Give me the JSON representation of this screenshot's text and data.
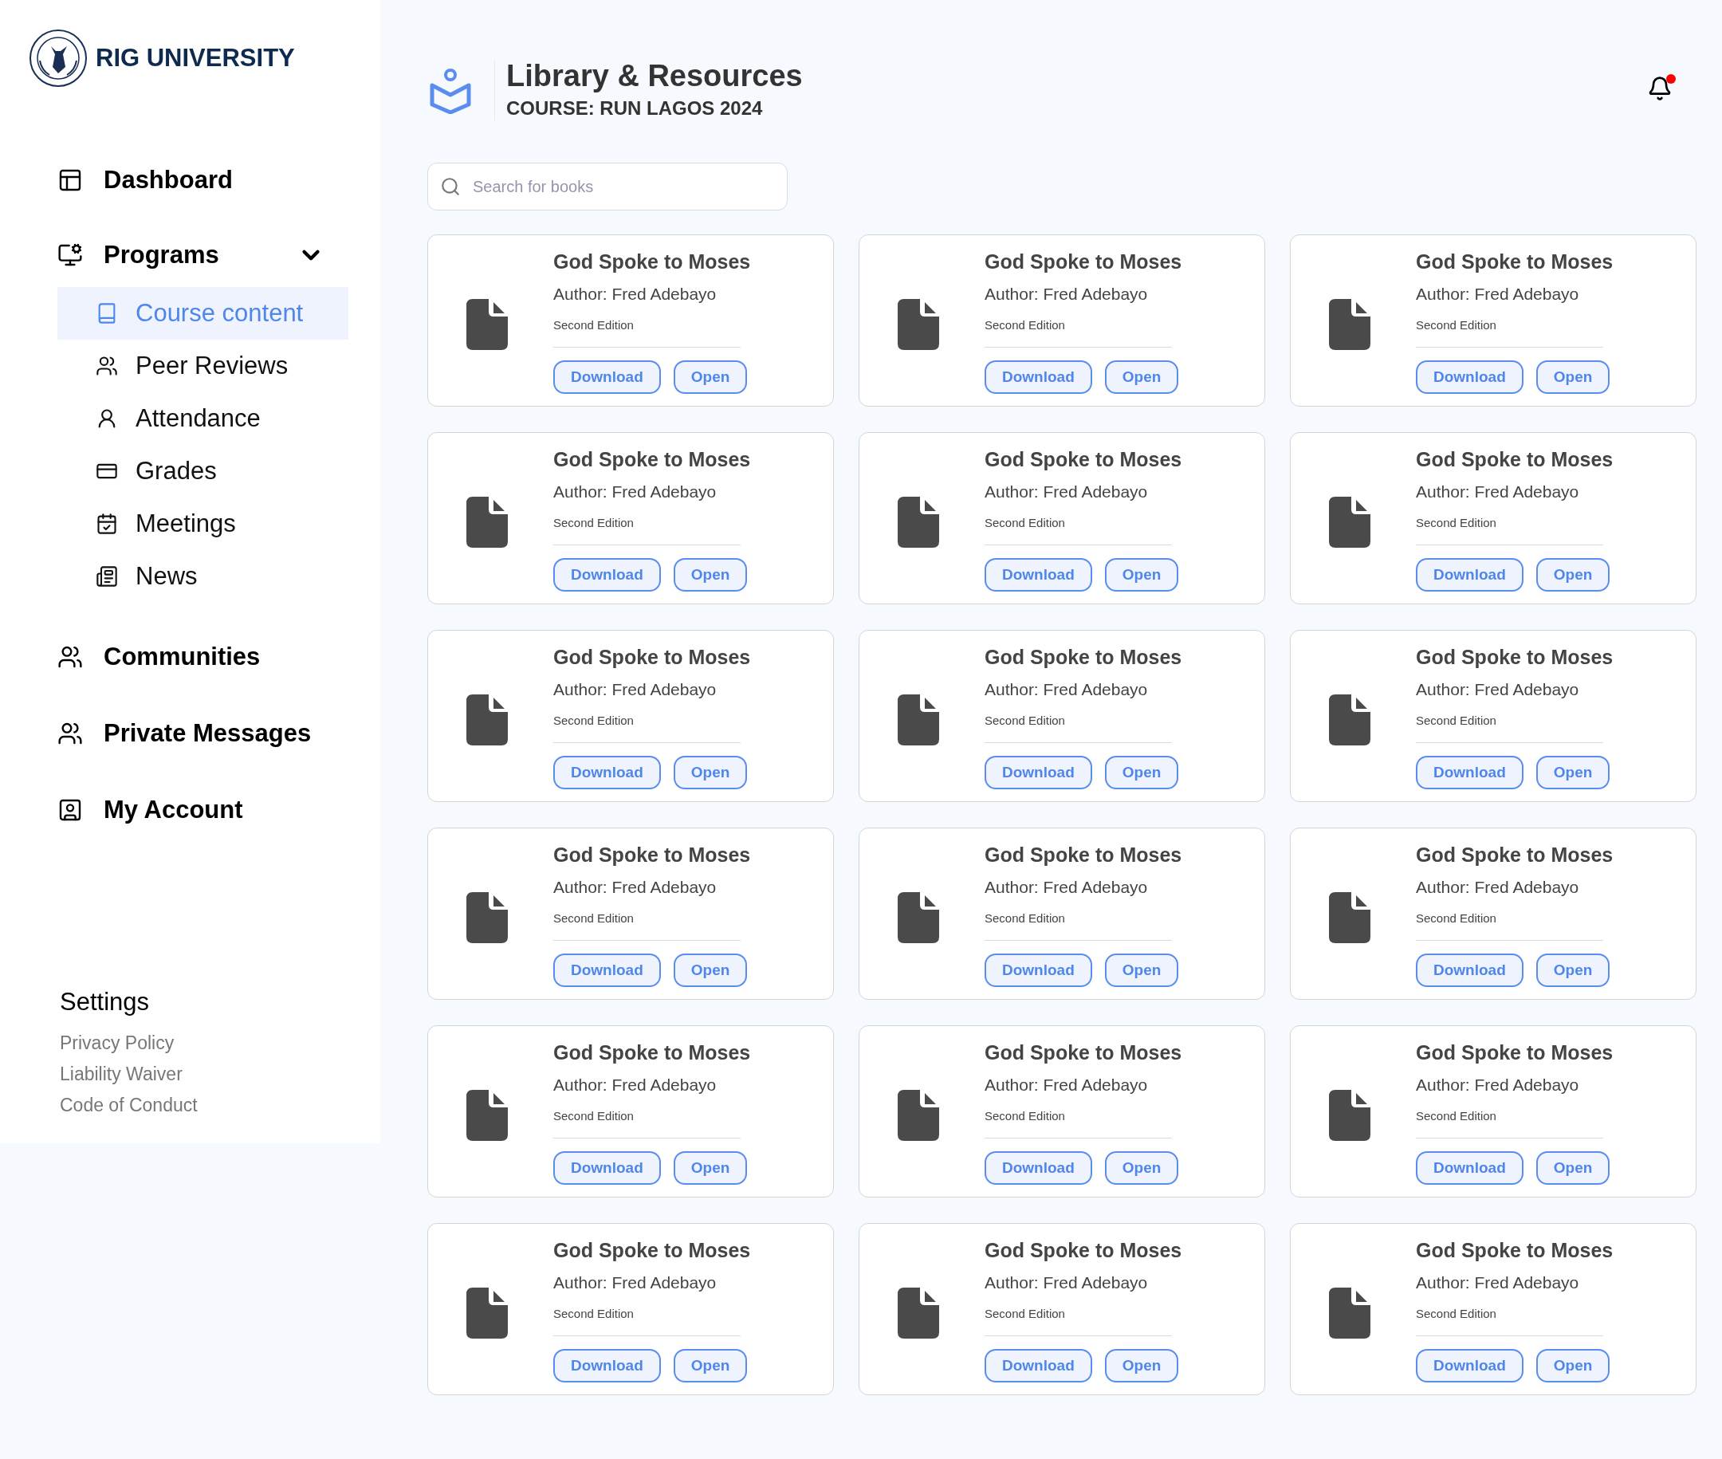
{
  "brand": {
    "name": "RIG UNIVERSITY"
  },
  "nav": [
    {
      "kind": "link",
      "label": "Dashboard"
    },
    {
      "kind": "group",
      "label": "Programs",
      "expanded": true,
      "children": [
        {
          "label": "Course content",
          "selected": true
        },
        {
          "label": "Peer Reviews",
          "selected": false
        },
        {
          "label": "Attendance",
          "selected": false
        },
        {
          "label": "Grades",
          "selected": false
        },
        {
          "label": "Meetings",
          "selected": false
        },
        {
          "label": "News",
          "selected": false
        }
      ]
    },
    {
      "kind": "link",
      "label": "Communities"
    },
    {
      "kind": "link",
      "label": "Private Messages"
    },
    {
      "kind": "link",
      "label": "My Account"
    }
  ],
  "settings": {
    "title": "Settings",
    "links": [
      "Privacy Policy",
      "Liability Waiver",
      "Code of Conduct"
    ]
  },
  "header": {
    "title": "Library & Resources",
    "subtitle": "COURSE: RUN LAGOS 2024",
    "notifications_unread": true
  },
  "search": {
    "placeholder": "Search for books"
  },
  "books": [
    {
      "title": "God Spoke to Moses",
      "author": "Author: Fred Adebayo",
      "edition": "Second Edition",
      "buttons": [
        "Download",
        "Open"
      ]
    },
    {
      "title": "God Spoke to Moses",
      "author": "Author: Fred Adebayo",
      "edition": "Second Edition",
      "buttons": [
        "Download",
        "Open"
      ]
    },
    {
      "title": "God Spoke to Moses",
      "author": "Author: Fred Adebayo",
      "edition": "Second Edition",
      "buttons": [
        "Download",
        "Open"
      ]
    },
    {
      "title": "God Spoke to Moses",
      "author": "Author: Fred Adebayo",
      "edition": "Second Edition",
      "buttons": [
        "Download",
        "Open"
      ]
    },
    {
      "title": "God Spoke to Moses",
      "author": "Author: Fred Adebayo",
      "edition": "Second Edition",
      "buttons": [
        "Download",
        "Open"
      ]
    },
    {
      "title": "God Spoke to Moses",
      "author": "Author: Fred Adebayo",
      "edition": "Second Edition",
      "buttons": [
        "Download",
        "Open"
      ]
    },
    {
      "title": "God Spoke to Moses",
      "author": "Author: Fred Adebayo",
      "edition": "Second Edition",
      "buttons": [
        "Download",
        "Open"
      ]
    },
    {
      "title": "God Spoke to Moses",
      "author": "Author: Fred Adebayo",
      "edition": "Second Edition",
      "buttons": [
        "Download",
        "Open"
      ]
    },
    {
      "title": "God Spoke to Moses",
      "author": "Author: Fred Adebayo",
      "edition": "Second Edition",
      "buttons": [
        "Download",
        "Open"
      ]
    },
    {
      "title": "God Spoke to Moses",
      "author": "Author: Fred Adebayo",
      "edition": "Second Edition",
      "buttons": [
        "Download",
        "Open"
      ]
    },
    {
      "title": "God Spoke to Moses",
      "author": "Author: Fred Adebayo",
      "edition": "Second Edition",
      "buttons": [
        "Download",
        "Open"
      ]
    },
    {
      "title": "God Spoke to Moses",
      "author": "Author: Fred Adebayo",
      "edition": "Second Edition",
      "buttons": [
        "Download",
        "Open"
      ]
    },
    {
      "title": "God Spoke to Moses",
      "author": "Author: Fred Adebayo",
      "edition": "Second Edition",
      "buttons": [
        "Download",
        "Open"
      ]
    },
    {
      "title": "God Spoke to Moses",
      "author": "Author: Fred Adebayo",
      "edition": "Second Edition",
      "buttons": [
        "Download",
        "Open"
      ]
    },
    {
      "title": "God Spoke to Moses",
      "author": "Author: Fred Adebayo",
      "edition": "Second Edition",
      "buttons": [
        "Download",
        "Open"
      ]
    },
    {
      "title": "God Spoke to Moses",
      "author": "Author: Fred Adebayo",
      "edition": "Second Edition",
      "buttons": [
        "Download",
        "Open"
      ]
    },
    {
      "title": "God Spoke to Moses",
      "author": "Author: Fred Adebayo",
      "edition": "Second Edition",
      "buttons": [
        "Download",
        "Open"
      ]
    },
    {
      "title": "God Spoke to Moses",
      "author": "Author: Fred Adebayo",
      "edition": "Second Edition",
      "buttons": [
        "Download",
        "Open"
      ]
    }
  ]
}
